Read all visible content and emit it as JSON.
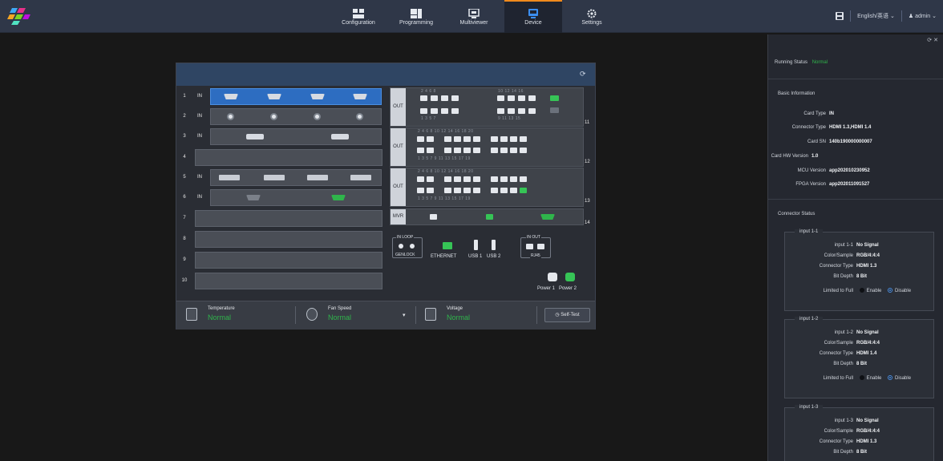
{
  "topbar": {
    "nav": [
      {
        "label": "Configuration",
        "icon": "configuration-icon"
      },
      {
        "label": "Programming",
        "icon": "programming-icon"
      },
      {
        "label": "Multiviewer",
        "icon": "multiviewer-icon"
      },
      {
        "label": "Device",
        "icon": "device-icon",
        "active": true
      },
      {
        "label": "Settings",
        "icon": "settings-icon"
      }
    ],
    "language": "English/英语",
    "user": "admin",
    "accent": "#f08a1c"
  },
  "device": {
    "slots": [
      {
        "num": "1",
        "in": "IN"
      },
      {
        "num": "2",
        "in": "IN"
      },
      {
        "num": "3",
        "in": "IN"
      },
      {
        "num": "4",
        "in": ""
      },
      {
        "num": "5",
        "in": "IN"
      },
      {
        "num": "6",
        "in": "IN"
      },
      {
        "num": "7",
        "in": ""
      },
      {
        "num": "8",
        "in": ""
      },
      {
        "num": "9",
        "in": ""
      },
      {
        "num": "10",
        "in": ""
      }
    ],
    "out_label": "OUT",
    "out_numbers": [
      "11",
      "12",
      "13",
      "14"
    ],
    "mvr_label": "MVR",
    "genlock": {
      "in_loop": "IN   LOOP",
      "label": "GENLOCK"
    },
    "ethernet": "ETHERNET",
    "usb1": "USB 1",
    "usb2": "USB 2",
    "rj45": {
      "in_out": "IN   OUT",
      "label": "RJ45"
    },
    "power1": "Power 1",
    "power2": "Power 2",
    "top_even_a": "2   4   6   8",
    "top_even_b": "10  12  14  16",
    "bot_odd_a": "1   3   5   7",
    "bot_odd_b": "9   11  13  15",
    "top_even_c": "2   4      6   8   10  12      14  16  18  20",
    "bot_odd_c": "1   3      5   7   9   11      13  15  17  19"
  },
  "status": {
    "temperature_label": "Temperature",
    "temperature_value": "Normal",
    "fan_label": "Fan Speed",
    "fan_value": "Normal",
    "voltage_label": "Voltage",
    "voltage_value": "Normal",
    "selftest_label": "Self-Test",
    "ok_color": "#2fb54b"
  },
  "info": {
    "running_status_label": "Running Status",
    "running_status_value": "Normal",
    "basic_info_title": "Basic Information",
    "card_type_label": "Card Type",
    "card_type_value": "IN",
    "connector_type_label": "Connector Type",
    "connector_type_value": "HDMI 1.3,HDMI 1.4",
    "card_sn_label": "Card SN",
    "card_sn_value": "140b190000000007",
    "card_hw_label": "Card HW Version",
    "card_hw_value": "1.0",
    "mcu_label": "MCU Version",
    "mcu_value": "app202010230952",
    "fpga_label": "FPGA Version",
    "fpga_value": "app202011091527",
    "connector_status_title": "Connector Status",
    "inputs": [
      {
        "title": "input 1-1",
        "name": "input 1-1",
        "signal": "No Signal",
        "color_label": "Color/Sample",
        "color_value": "RGB/4:4:4",
        "ctype_label": "Connector Type",
        "ctype_value": "HDMI 1.3",
        "depth_label": "Bit Depth",
        "depth_value": "8 Bit",
        "limited_label": "Limited to Full",
        "enable": "Enable",
        "disable": "Disable"
      },
      {
        "title": "input 1-2",
        "name": "input 1-2",
        "signal": "No Signal",
        "color_label": "Color/Sample",
        "color_value": "RGB/4:4:4",
        "ctype_label": "Connector Type",
        "ctype_value": "HDMI 1.4",
        "depth_label": "Bit Depth",
        "depth_value": "8 Bit",
        "limited_label": "Limited to Full",
        "enable": "Enable",
        "disable": "Disable"
      },
      {
        "title": "input 1-3",
        "name": "input 1-3",
        "signal": "No Signal",
        "color_label": "Color/Sample",
        "color_value": "RGB/4:4:4",
        "ctype_label": "Connector Type",
        "ctype_value": "HDMI 1.3",
        "depth_label": "Bit Depth",
        "depth_value": "8 Bit"
      }
    ]
  }
}
